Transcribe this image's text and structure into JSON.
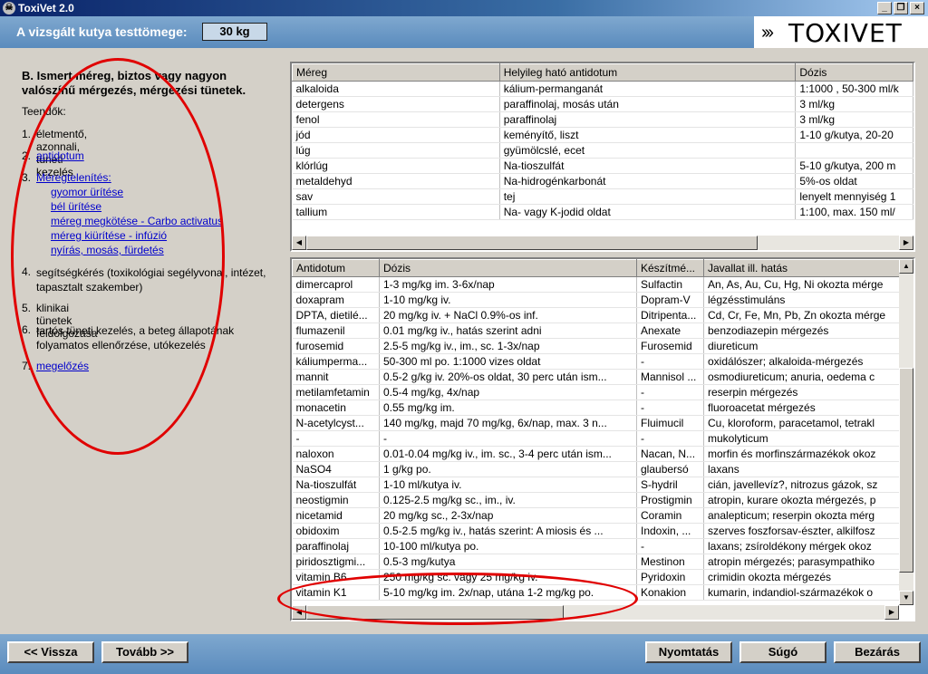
{
  "window": {
    "title": "ToxiVet 2.0"
  },
  "header": {
    "weight_label": "A vizsgált kutya testtömege:",
    "weight_value": "30 kg",
    "logo_chevrons": "›››",
    "logo_text": "TOXIVET"
  },
  "left": {
    "section_title": "B. Ismert méreg, biztos vagy nagyon valószínű mérgezés, mérgezési tünetek.",
    "todo_label": "Teendők:",
    "steps": [
      {
        "num": "1.",
        "text": "életmentő, azonnali, tüneti kezelés"
      },
      {
        "num": "2.",
        "text": "antidotum"
      },
      {
        "num": "3.",
        "text": "Méregtelenítés:"
      },
      {
        "num": "4.",
        "text": "segítségkérés (toxikológiai segélyvonal, intézet, tapasztalt szakember)"
      },
      {
        "num": "5.",
        "text": "klinikai tünetek feldolgozása"
      },
      {
        "num": "6.",
        "text": "tartós tüneti kezelés, a beteg állapotának folyamatos ellenőrzése, utókezelés"
      },
      {
        "num": "7.",
        "text": "megelőzés"
      }
    ],
    "substeps": [
      "gyomor ürítése",
      "bél ürítése",
      "méreg megkötése - Carbo activatus",
      "méreg kiürítése - infúzió",
      "nyírás, mosás, fürdetés"
    ]
  },
  "table1": {
    "headers": [
      "Méreg",
      "Helyileg ható antidotum",
      "Dózis"
    ],
    "rows": [
      [
        "alkaloida",
        "kálium-permanganát",
        "1:1000 , 50-300 ml/k"
      ],
      [
        "detergens",
        "paraffinolaj, mosás után",
        "3 ml/kg"
      ],
      [
        "fenol",
        "paraffinolaj",
        "3 ml/kg"
      ],
      [
        "jód",
        "keményítő, liszt",
        "1-10 g/kutya, 20-20"
      ],
      [
        "lúg",
        "gyümölcslé, ecet",
        ""
      ],
      [
        "klórlúg",
        "Na-tioszulfát",
        "5-10 g/kutya, 200 m"
      ],
      [
        "metaldehyd",
        "Na-hidrogénkarbonát",
        "5%-os oldat"
      ],
      [
        "sav",
        "tej",
        "lenyelt mennyiség 1"
      ],
      [
        "tallium",
        "Na- vagy K-jodid oldat",
        "1:100, max. 150 ml/"
      ]
    ]
  },
  "table2": {
    "headers": [
      "Antidotum",
      "Dózis",
      "Készítmé...",
      "Javallat ill. hatás"
    ],
    "rows": [
      [
        "dimercaprol",
        "1-3 mg/kg im. 3-6x/nap",
        "Sulfactin",
        "An, As, Au, Cu, Hg, Ni okozta mérge"
      ],
      [
        "doxapram",
        "1-10 mg/kg iv.",
        "Dopram-V",
        "légzésstimuláns"
      ],
      [
        "DPTA, dietilé...",
        "20 mg/kg iv. + NaCl 0.9%-os inf.",
        "Ditripenta...",
        "Cd, Cr, Fe, Mn, Pb, Zn okozta mérge"
      ],
      [
        "flumazenil",
        "0.01 mg/kg iv., hatás szerint adni",
        "Anexate",
        "benzodiazepin mérgezés"
      ],
      [
        "furosemid",
        "2.5-5 mg/kg iv., im., sc. 1-3x/nap",
        "Furosemid",
        "diureticum"
      ],
      [
        "káliumperma...",
        "50-300 ml po. 1:1000 vizes oldat",
        "-",
        "oxidálószer; alkaloida-mérgezés"
      ],
      [
        "mannit",
        "0.5-2 g/kg iv. 20%-os oldat, 30 perc után ism...",
        "Mannisol ...",
        "osmodiureticum; anuria, oedema c"
      ],
      [
        "metilamfetamin",
        "0.5-4 mg/kg, 4x/nap",
        "-",
        "reserpin mérgezés"
      ],
      [
        "monacetin",
        "0.55 mg/kg im.",
        "-",
        "fluoroacetat mérgezés"
      ],
      [
        "N-acetylcyst...",
        "140 mg/kg, majd 70 mg/kg, 6x/nap, max. 3 n...",
        "Fluimucil",
        "Cu, kloroform, paracetamol, tetrakl"
      ],
      [
        "-",
        "-",
        "-",
        "mukolyticum"
      ],
      [
        "naloxon",
        "0.01-0.04 mg/kg iv., im. sc., 3-4 perc után ism...",
        "Nacan, N...",
        "morfin és morfinszármazékok okoz"
      ],
      [
        "NaSO4",
        "1 g/kg po.",
        "glaubersó",
        "laxans"
      ],
      [
        "Na-tioszulfát",
        "1-10 ml/kutya iv.",
        "S-hydril",
        "cián, javellevíz?, nitrozus gázok, sz"
      ],
      [
        "neostigmin",
        "0.125-2.5 mg/kg sc., im., iv.",
        "Prostigmin",
        "atropin, kurare okozta mérgezés, p"
      ],
      [
        "nicetamid",
        "20 mg/kg sc., 2-3x/nap",
        "Coramin",
        "analepticum; reserpin okozta mérg"
      ],
      [
        "obidoxim",
        "0.5-2.5 mg/kg iv., hatás szerint: A miosis és ...",
        "Indoxin, ...",
        "szerves foszforsav-észter, alkilfosz"
      ],
      [
        "paraffinolaj",
        "10-100 ml/kutya po.",
        "-",
        "laxans; zsíroldékony mérgek okoz"
      ],
      [
        "piridosztigmi...",
        "0.5-3 mg/kutya",
        "Mestinon",
        "atropin mérgezés; parasympathiko"
      ],
      [
        "vitamin B6",
        "250 mg/kg sc. vagy 25 mg/kg iv.",
        "Pyridoxin",
        "crimidin okozta mérgezés"
      ],
      [
        "vitamin K1",
        "5-10 mg/kg im. 2x/nap, utána 1-2 mg/kg po.",
        "Konakion",
        "kumarin, indandiol-származékok o"
      ]
    ]
  },
  "footer": {
    "back": "<< Vissza",
    "next": "Tovább >>",
    "print": "Nyomtatás",
    "help": "Súgó",
    "close": "Bezárás"
  },
  "colors": {
    "accent_red": "#e00000",
    "bar_blue": "#6a98c6"
  }
}
